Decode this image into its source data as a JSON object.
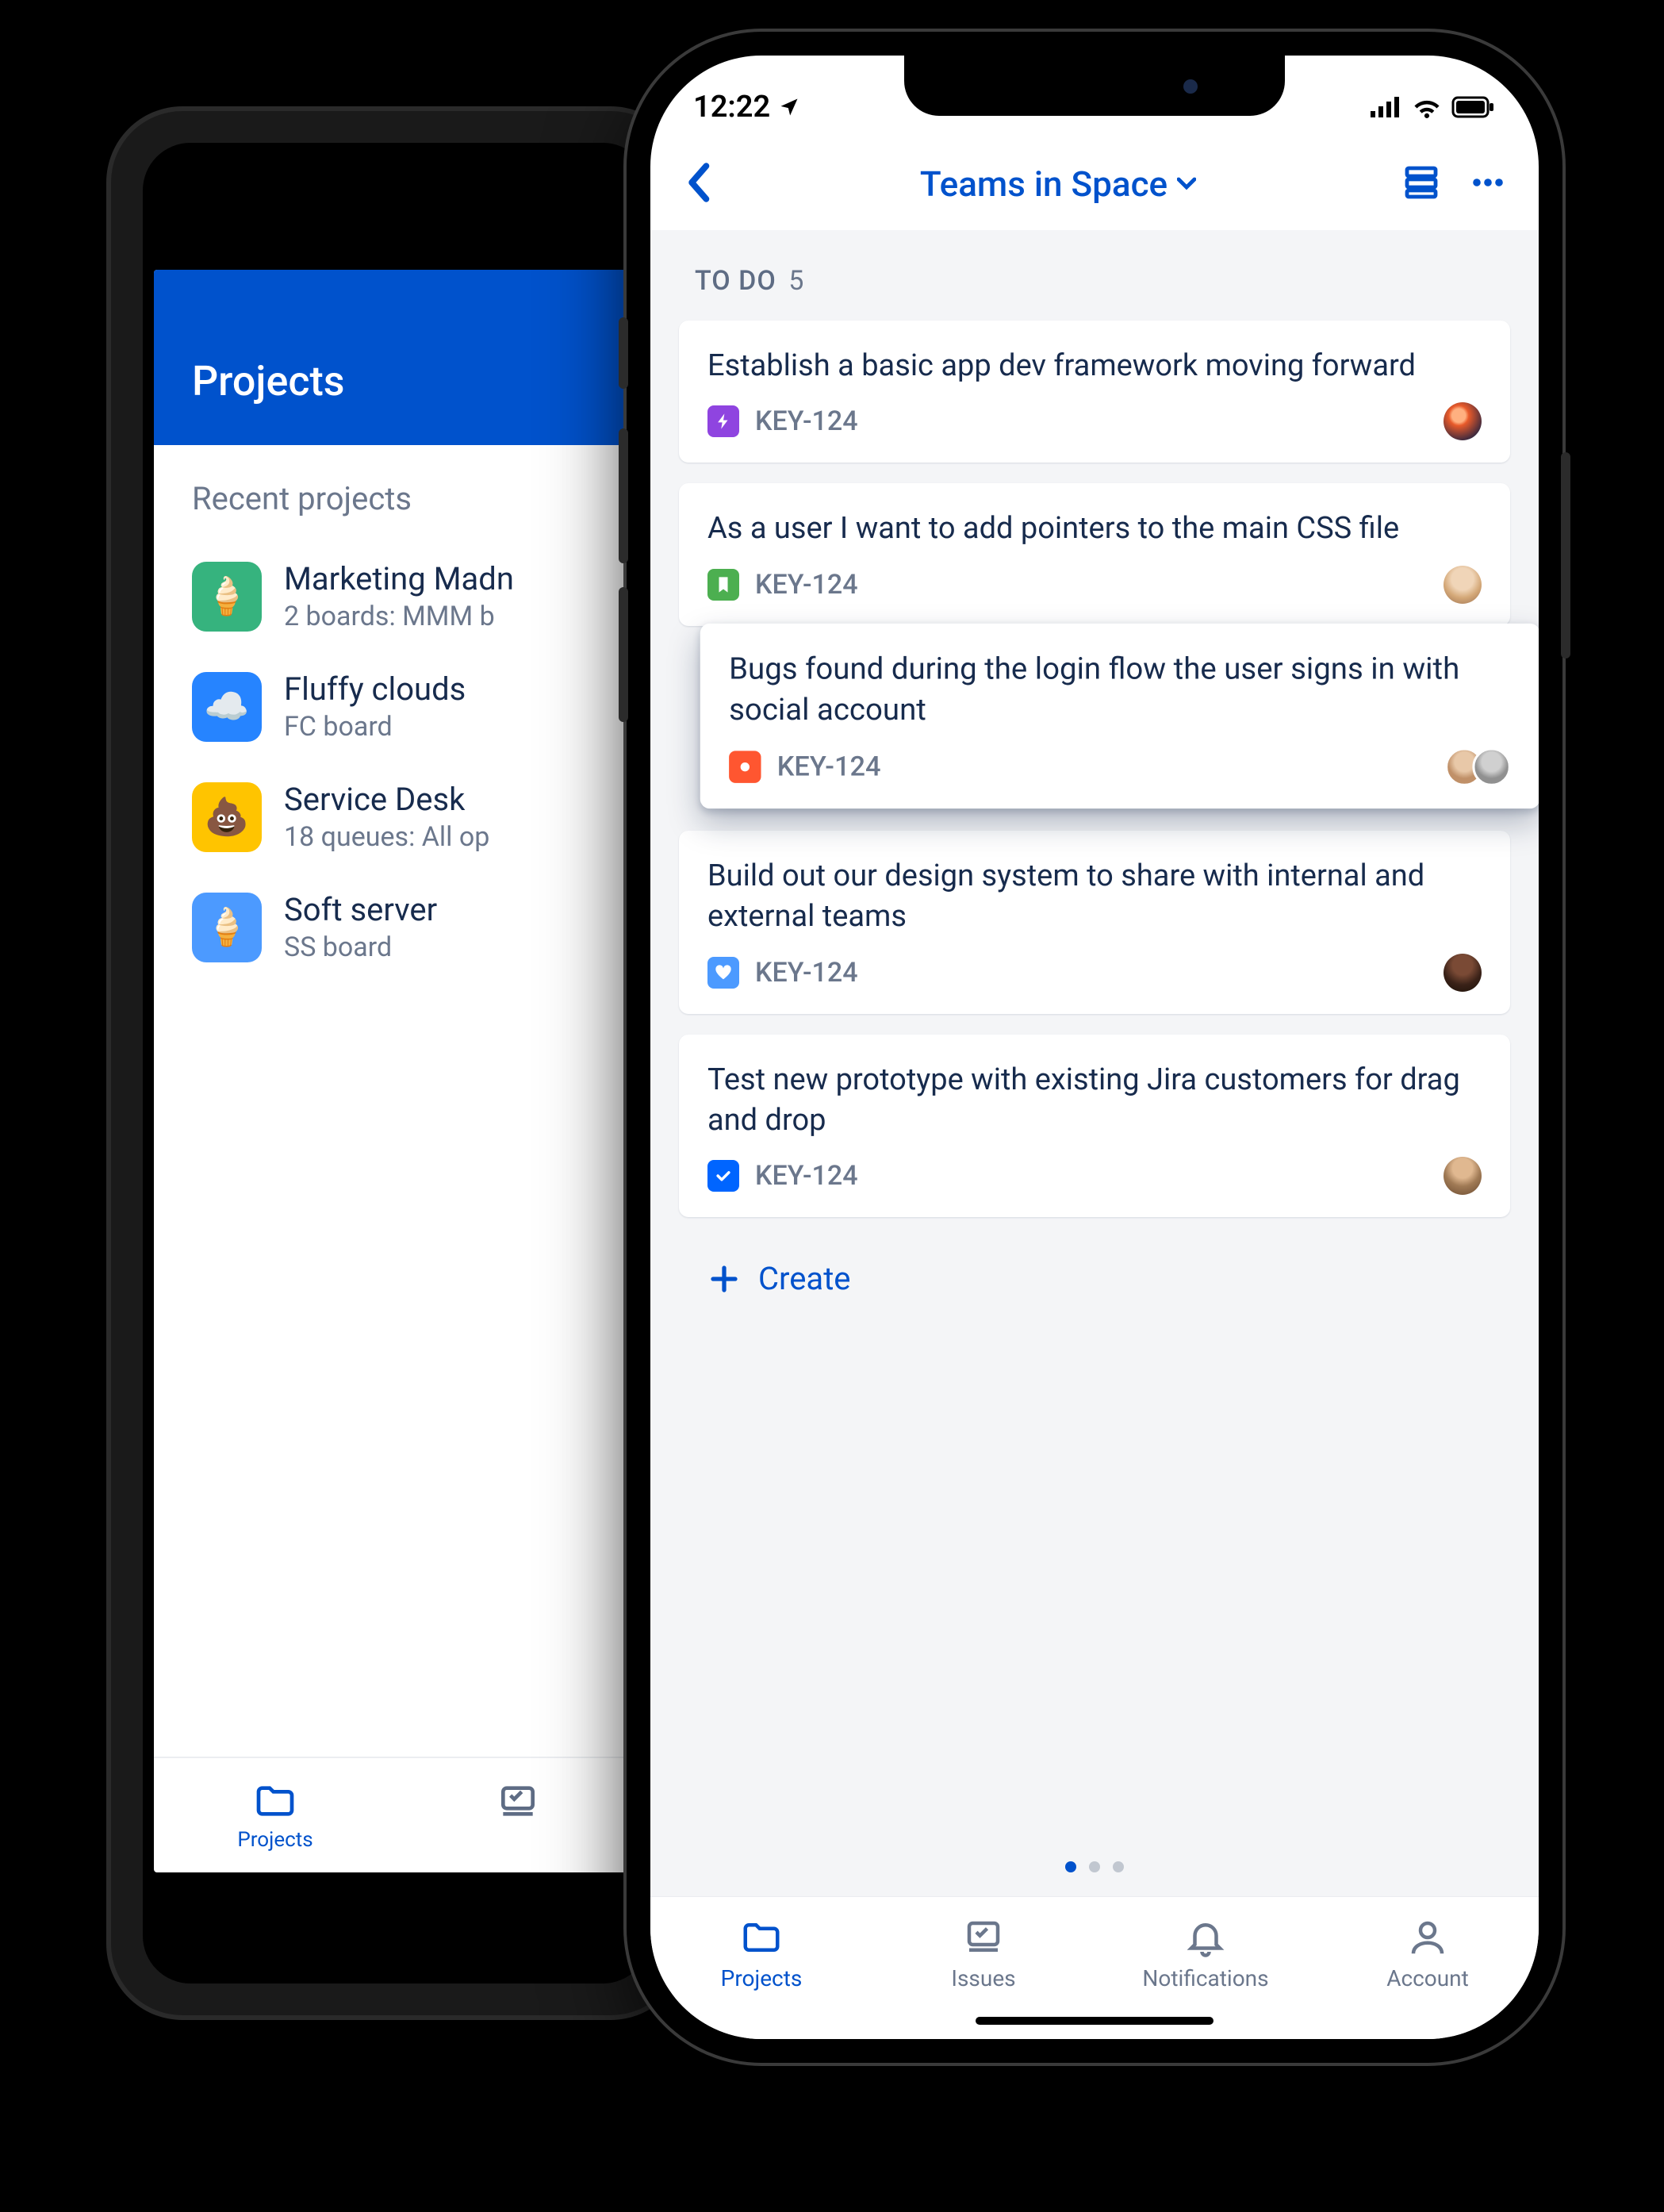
{
  "android": {
    "header_title": "Projects",
    "section_label": "Recent projects",
    "projects": [
      {
        "name": "Marketing Madn",
        "sub": "2 boards: MMM b",
        "icon_bg": "#36B37E",
        "icon_glyph": "🍦"
      },
      {
        "name": "Fluffy clouds",
        "sub": "FC board",
        "icon_bg": "#2684FF",
        "icon_glyph": "☁️"
      },
      {
        "name": "Service Desk",
        "sub": "18 queues: All op",
        "icon_bg": "#FFC400",
        "icon_glyph": "💩"
      },
      {
        "name": "Soft server",
        "sub": "SS board",
        "icon_bg": "#4C9AFF",
        "icon_glyph": "🍦"
      }
    ],
    "tabs": {
      "projects": "Projects"
    }
  },
  "iphone": {
    "status_time": "12:22",
    "nav_title": "Teams in Space",
    "column": {
      "name": "TO DO",
      "count": "5"
    },
    "cards": [
      {
        "title": "Establish a basic app dev framework moving forward",
        "key": "KEY-124",
        "type_bg": "#8F44E0",
        "type_icon": "bolt",
        "avatar_bg": "#e85a2a"
      },
      {
        "title": "As a user I want to add pointers to the main CSS file",
        "key": "KEY-124",
        "type_bg": "#4CAF50",
        "type_icon": "bookmark",
        "avatar_bg": "#e7c8a7"
      },
      {
        "title": "Bugs found during the login flow the user signs in with social account",
        "key": "KEY-124",
        "type_bg": "#FF5630",
        "type_icon": "dot",
        "avatar_bg": "#d9b89a",
        "avatar2_bg": "#b0b0b0"
      },
      {
        "title": "Build out our design system to share with internal and external teams",
        "key": "KEY-124",
        "type_bg": "#4C9AFF",
        "type_icon": "heart",
        "avatar_bg": "#6e3e2c"
      },
      {
        "title": "Test new prototype with existing Jira customers for drag and drop",
        "key": "KEY-124",
        "type_bg": "#0065FF",
        "type_icon": "check",
        "avatar_bg": "#caa07a"
      }
    ],
    "create_label": "Create",
    "tabs": {
      "projects": "Projects",
      "issues": "Issues",
      "notifications": "Notifications",
      "account": "Account"
    }
  }
}
